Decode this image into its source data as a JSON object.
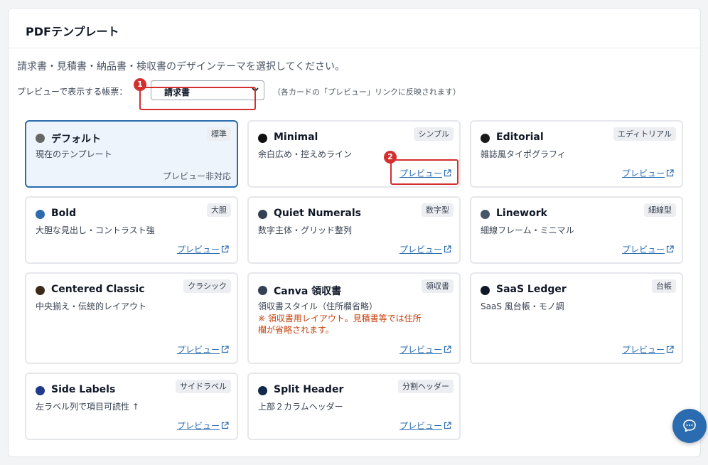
{
  "panel": {
    "title": "PDFテンプレート"
  },
  "description": "請求書・見積書・納品書・検収書のデザインテーマを選択してください。",
  "controls": {
    "label": "プレビューで表示する帳票：",
    "selected_value": "請求書",
    "note": "（各カードの「プレビュー」リンクに反映されます）"
  },
  "steps": {
    "one": "1",
    "two": "2"
  },
  "preview_label": "プレビュー",
  "templates": [
    {
      "name": "デフォルト",
      "desc": "現在のテンプレート",
      "tag": "標準",
      "color": "#666666",
      "preview_status": "プレビュー非対応",
      "selected": true
    },
    {
      "name": "Minimal",
      "desc": "余白広め・控えめライン",
      "tag": "シンプル",
      "color": "#111111"
    },
    {
      "name": "Editorial",
      "desc": "雑誌風タイポグラフィ",
      "tag": "エディトリアル",
      "color": "#1a1a1a"
    },
    {
      "name": "Bold",
      "desc": "大胆な見出し・コントラスト強",
      "tag": "大胆",
      "color": "#2b6cb0"
    },
    {
      "name": "Quiet Numerals",
      "desc": "数字主体・グリッド整列",
      "tag": "数字型",
      "color": "#334155"
    },
    {
      "name": "Linework",
      "desc": "細線フレーム・ミニマル",
      "tag": "細線型",
      "color": "#475569"
    },
    {
      "name": "Centered Classic",
      "desc": "中央揃え・伝統的レイアウト",
      "tag": "クラシック",
      "color": "#3b2a1a"
    },
    {
      "name": "Canva 領収書",
      "desc": "領収書スタイル（住所欄省略）",
      "tag": "領収書",
      "color": "#334155",
      "warning": "※ 領収書用レイアウト。見積書等では住所欄が省略されます。"
    },
    {
      "name": "SaaS Ledger",
      "desc": "SaaS 風台帳・モノ調",
      "tag": "台帳",
      "color": "#111827"
    },
    {
      "name": "Side Labels",
      "desc": "左ラベル列で項目可読性 ↑",
      "tag": "サイドラベル",
      "color": "#1e3a8a"
    },
    {
      "name": "Split Header",
      "desc": "上部２カラムヘッダー",
      "tag": "分割ヘッダー",
      "color": "#0f2a4a"
    }
  ],
  "colors": {
    "accent": "#2b6cb0",
    "highlight": "#d32f2f",
    "warning": "#c2410c"
  },
  "icons": {
    "external_link": "external-link-icon",
    "chevron": "chevron-down-icon",
    "chat": "chat-bubble-icon"
  }
}
